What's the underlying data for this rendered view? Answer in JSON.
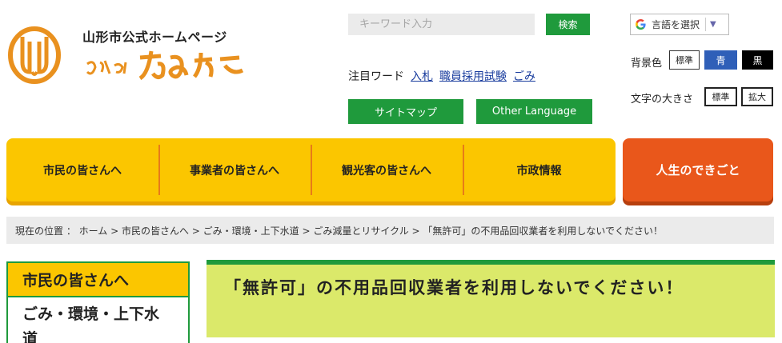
{
  "header": {
    "site_name": "山形市公式ホームページ",
    "slogan": "なんだりかんだり やまがた",
    "logo_icon": "yamagata-city-emblem"
  },
  "search": {
    "placeholder": "キーワード入力",
    "button_label": "検索"
  },
  "language": {
    "label": "言語を選択",
    "icon": "google-g-icon"
  },
  "attention": {
    "label": "注目ワード",
    "links": [
      "入札",
      "職員採用試験",
      "ごみ"
    ]
  },
  "buttons": {
    "sitemap": "サイトマップ",
    "other_language": "Other Language"
  },
  "display": {
    "bg_label": "背景色",
    "bg_options": [
      "標準",
      "青",
      "黒"
    ],
    "size_label": "文字の大きさ",
    "size_options": [
      "標準",
      "拡大"
    ]
  },
  "nav": {
    "items": [
      "市民の皆さんへ",
      "事業者の皆さんへ",
      "観光客の皆さんへ",
      "市政情報"
    ],
    "life_events": "人生のできごと"
  },
  "breadcrumb": "現在の位置 ： ホーム > 市民の皆さんへ > ごみ・環境・上下水道 > ごみ減量とリサイクル > 「無許可」の不用品回収業者を利用しないでください！",
  "sidebar": {
    "heading": "市民の皆さんへ",
    "item": "ごみ・環境・上下水道"
  },
  "page_title": "「無許可」の不用品回収業者を利用しないでください！",
  "colors": {
    "green": "#1f9a3c",
    "yellow": "#fbc600",
    "orange": "#e9571b",
    "logo_orange": "#e9911f"
  }
}
